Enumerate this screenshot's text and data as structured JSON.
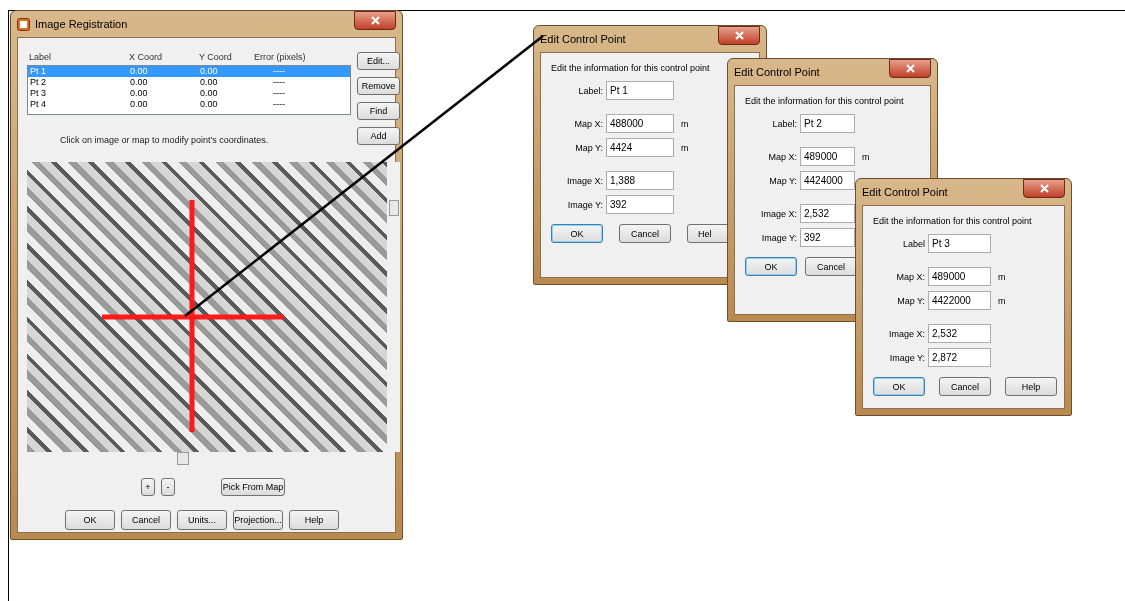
{
  "main_window": {
    "title": "Image Registration",
    "table": {
      "columns": [
        "Label",
        "X Coord",
        "Y Coord",
        "Error (pixels)"
      ],
      "rows": [
        {
          "cells": [
            "Pt 1",
            "0.00",
            "0.00",
            "----"
          ],
          "selected": true
        },
        {
          "cells": [
            "Pt 2",
            "0.00",
            "0.00",
            "----"
          ],
          "selected": false
        },
        {
          "cells": [
            "Pt 3",
            "0.00",
            "0.00",
            "----"
          ],
          "selected": false
        },
        {
          "cells": [
            "Pt 4",
            "0.00",
            "0.00",
            "----"
          ],
          "selected": false
        }
      ]
    },
    "side_buttons": [
      "Edit...",
      "Remove",
      "Find",
      "Add"
    ],
    "hint": "Click on image or map to modify point's coordinates.",
    "zoom_buttons": [
      "+",
      "-"
    ],
    "pick_button": "Pick From Map",
    "buttons": [
      "OK",
      "Cancel",
      "Units...",
      "Projection...",
      "Help"
    ]
  },
  "dialogs": [
    {
      "title": "Edit Control Point",
      "instruction": "Edit the information for this control point",
      "fields": [
        {
          "label": "Label:",
          "value": "Pt 1"
        },
        {
          "label": "Map X:",
          "value": "488000",
          "unit": "m"
        },
        {
          "label": "Map Y:",
          "value": "4424",
          "unit": "m"
        },
        {
          "label": "Image X:",
          "value": "1,388"
        },
        {
          "label": "Image Y:",
          "value": "392"
        }
      ],
      "buttons": [
        "OK",
        "Cancel",
        "Hel"
      ]
    },
    {
      "title": "Edit Control Point",
      "instruction": "Edit the information for this control point",
      "fields": [
        {
          "label": "Label:",
          "value": "Pt 2"
        },
        {
          "label": "Map X:",
          "value": "489000",
          "unit": "m"
        },
        {
          "label": "Map Y:",
          "value": "4424000"
        },
        {
          "label": "Image X:",
          "value": "2,532"
        },
        {
          "label": "Image Y:",
          "value": "392"
        }
      ],
      "buttons": [
        "OK",
        "Cancel"
      ]
    },
    {
      "title": "Edit Control Point",
      "instruction": "Edit the information for this control point",
      "fields": [
        {
          "label": "Label",
          "value": "Pt 3"
        },
        {
          "label": "Map X:",
          "value": "489000",
          "unit": "m"
        },
        {
          "label": "Map Y:",
          "value": "4422000",
          "unit": "m"
        },
        {
          "label": "Image X:",
          "value": "2,532"
        },
        {
          "label": "Image Y:",
          "value": "2,872"
        }
      ],
      "buttons": [
        "OK",
        "Cancel",
        "Help"
      ]
    }
  ]
}
